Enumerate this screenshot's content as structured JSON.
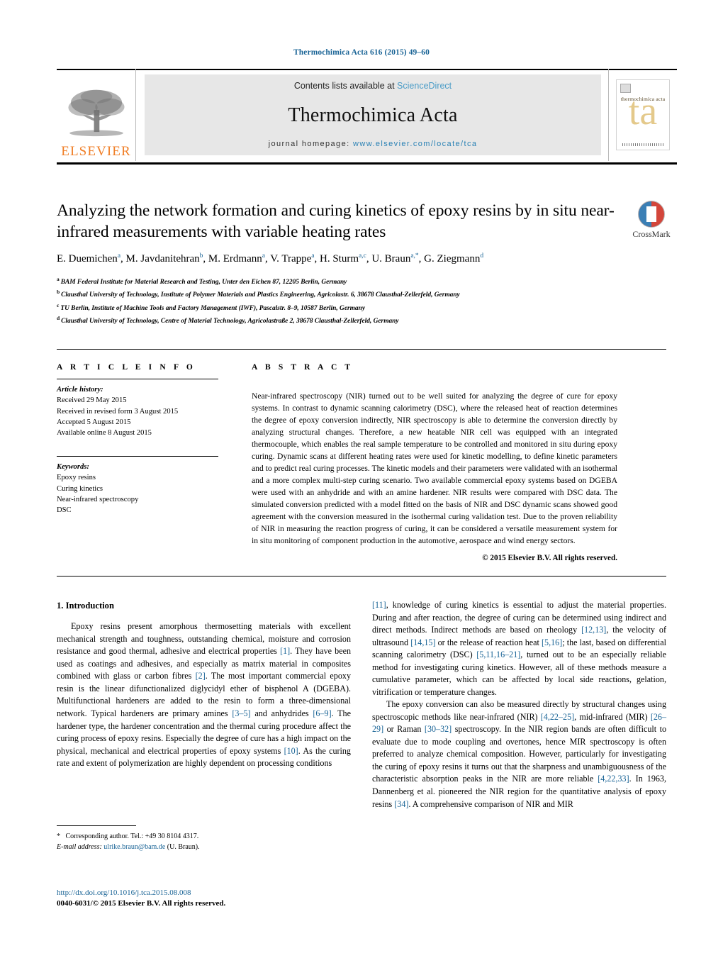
{
  "running_head": "Thermochimica Acta 616 (2015) 49–60",
  "masthead": {
    "publisher_logo_label": "ELSEVIER",
    "contents_prefix": "Contents lists available at ",
    "contents_link": "ScienceDirect",
    "journal_title": "Thermochimica Acta",
    "homepage_prefix": "journal homepage: ",
    "homepage_url": "www.elsevier.com/locate/tca",
    "cover_title": "thermochimica acta",
    "cover_monogram": "ta"
  },
  "crossmark": {
    "label": "CrossMark"
  },
  "article": {
    "title": "Analyzing the network formation and curing kinetics of epoxy resins by in situ near-infrared measurements with variable heating rates",
    "authors_html": "E. Duemichen<sup>a</sup>, M. Javdanitehran<sup>b</sup>, M. Erdmann<sup>a</sup>, V. Trappe<sup>a</sup>, H. Sturm<sup>a,c</sup>, U. Braun<sup>a,*</sup>, G. Ziegmann<sup>d</sup>",
    "affiliations": [
      {
        "marker": "a",
        "text": "BAM Federal Institute for Material Research and Testing, Unter den Eichen 87, 12205 Berlin, Germany"
      },
      {
        "marker": "b",
        "text": "Clausthal University of Technology, Institute of Polymer Materials and Plastics Engineering, Agricolastr. 6, 38678 Clausthal-Zellerfeld, Germany"
      },
      {
        "marker": "c",
        "text": "TU Berlin, Institute of Machine Tools and Factory Management (IWF), Pascalstr. 8–9, 10587 Berlin, Germany"
      },
      {
        "marker": "d",
        "text": "Clausthal University of Technology, Centre of Material Technology, Agricolastraße 2, 38678 Clausthal-Zellerfeld, Germany"
      }
    ]
  },
  "article_info": {
    "heading": "A R T I C L E   I N F O",
    "history_label": "Article history:",
    "history": [
      "Received 29 May 2015",
      "Received in revised form 3 August 2015",
      "Accepted 5 August 2015",
      "Available online 8 August 2015"
    ],
    "keywords_label": "Keywords:",
    "keywords": [
      "Epoxy resins",
      "Curing kinetics",
      "Near-infrared spectroscopy",
      "DSC"
    ]
  },
  "abstract": {
    "heading": "A B S T R A C T",
    "text": "Near-infrared spectroscopy (NIR) turned out to be well suited for analyzing the degree of cure for epoxy systems. In contrast to dynamic scanning calorimetry (DSC), where the released heat of reaction determines the degree of epoxy conversion indirectly, NIR spectroscopy is able to determine the conversion directly by analyzing structural changes. Therefore, a new heatable NIR cell was equipped with an integrated thermocouple, which enables the real sample temperature to be controlled and monitored in situ during epoxy curing. Dynamic scans at different heating rates were used for kinetic modelling, to define kinetic parameters and to predict real curing processes. The kinetic models and their parameters were validated with an isothermal and a more complex multi-step curing scenario. Two available commercial epoxy systems based on DGEBA were used with an anhydride and with an amine hardener. NIR results were compared with DSC data. The simulated conversion predicted with a model fitted on the basis of NIR and DSC dynamic scans showed good agreement with the conversion measured in the isothermal curing validation test. Due to the proven reliability of NIR in measuring the reaction progress of curing, it can be considered a versatile measurement system for in situ monitoring of component production in the automotive, aerospace and wind energy sectors.",
    "copyright": "© 2015 Elsevier B.V. All rights reserved."
  },
  "introduction": {
    "heading": "1.  Introduction",
    "left_paragraph_html": "Epoxy resins present amorphous thermosetting materials with excellent mechanical strength and toughness, outstanding chemical, moisture and corrosion resistance and good thermal, adhesive and electrical properties <span class=\"ref\">[1]</span>. They have been used as coatings and adhesives, and especially as matrix material in composites combined with glass or carbon fibres <span class=\"ref\">[2]</span>. The most important commercial epoxy resin is the linear difunctionalized diglycidyl ether of bisphenol A (DGEBA). Multifunctional hardeners are added to the resin to form a three-dimensional network. Typical hardeners are primary amines <span class=\"ref\">[3–5]</span> and anhydrides <span class=\"ref\">[6–9]</span>. The hardener type, the hardener concentration and the thermal curing procedure affect the curing process of epoxy resins. Especially the degree of cure has a high impact on the physical, mechanical and electrical properties of epoxy systems <span class=\"ref\">[10]</span>. As the curing rate and extent of polymerization are highly dependent on processing conditions",
    "right_paragraph_1_html": "<span class=\"ref\">[11]</span>, knowledge of curing kinetics is essential to adjust the material properties. During and after reaction, the degree of curing can be determined using indirect and direct methods. Indirect methods are based on rheology <span class=\"ref\">[12,13]</span>, the velocity of ultrasound <span class=\"ref\">[14,15]</span> or the release of reaction heat <span class=\"ref\">[5,16]</span>; the last, based on differential scanning calorimetry (DSC) <span class=\"ref\">[5,11,16–21]</span>, turned out to be an especially reliable method for investigating curing kinetics. However, all of these methods measure a cumulative parameter, which can be affected by local side reactions, gelation, vitrification or temperature changes.",
    "right_paragraph_2_html": "The epoxy conversion can also be measured directly by structural changes using spectroscopic methods like near-infrared (NIR) <span class=\"ref\">[4,22–25]</span>, mid-infrared (MIR) <span class=\"ref\">[26–29]</span> or Raman <span class=\"ref\">[30–32]</span> spectroscopy. In the NIR region bands are often difficult to evaluate due to mode coupling and overtones, hence MIR spectroscopy is often preferred to analyze chemical composition. However, particularly for investigating the curing of epoxy resins it turns out that the sharpness and unambiguousness of the characteristic absorption peaks in the NIR are more reliable <span class=\"ref\">[4,22,33]</span>. In 1963, Dannenberg et al. pioneered the NIR region for the quantitative analysis of epoxy resins <span class=\"ref\">[34]</span>. A comprehensive comparison of NIR and MIR"
  },
  "footnote": {
    "corresponding_html": "<span class=\"star\">*</span> Corresponding author. Tel.: +49 30 8104 4317.",
    "email_label": "E-mail address:",
    "email": "ulrike.braun@bam.de",
    "email_suffix": "(U. Braun)."
  },
  "imprint": {
    "doi": "http://dx.doi.org/10.1016/j.tca.2015.08.008",
    "issn_line": "0040-6031/© 2015 Elsevier B.V. All rights reserved."
  },
  "colors": {
    "link": "#1a6496",
    "elsevier_orange": "#f07e26",
    "band_gray": "#e7e7e7"
  }
}
